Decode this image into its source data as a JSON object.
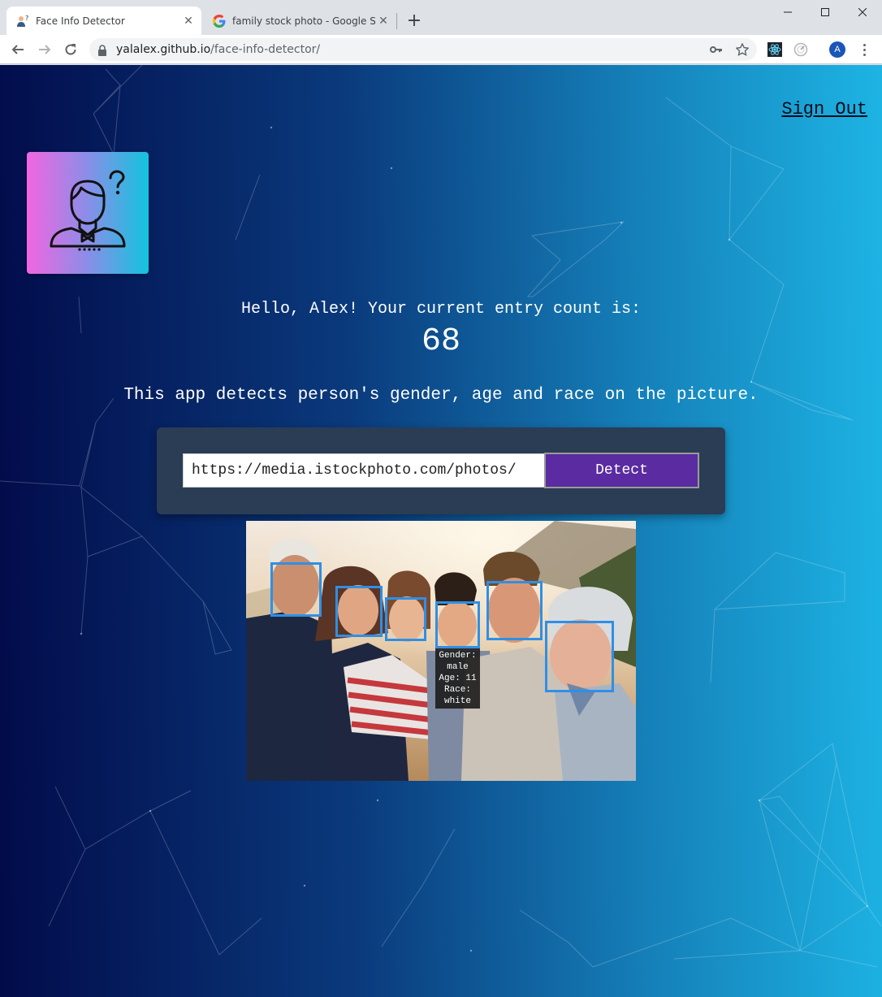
{
  "browser": {
    "tabs": [
      {
        "title": "Face Info Detector",
        "active": true,
        "icon": "person-question-favicon"
      },
      {
        "title": "family stock photo - Google Sear",
        "active": false,
        "icon": "google-favicon"
      }
    ],
    "address": {
      "domain": "yalalex.github.io",
      "path": "/face-info-detector/"
    },
    "profile_initial": "A"
  },
  "page": {
    "sign_out": "Sign Out",
    "greeting": "Hello, Alex! Your current entry count is:",
    "entry_count": "68",
    "tagline": "This app detects person's gender, age and race on the picture.",
    "form": {
      "url_value": "https://media.istockphoto.com/photos/",
      "detect_label": "Detect"
    },
    "detection": {
      "faces_detected": 6,
      "info_lines": [
        "Gender:",
        "male",
        "Age: 11",
        "Race:",
        "white"
      ]
    }
  },
  "colors": {
    "gradient_start": "#020b4a",
    "gradient_end": "#1db4e4",
    "detect_button": "#5a2ba1",
    "face_box": "#2f8fe6",
    "panel": "#2a3d55"
  }
}
